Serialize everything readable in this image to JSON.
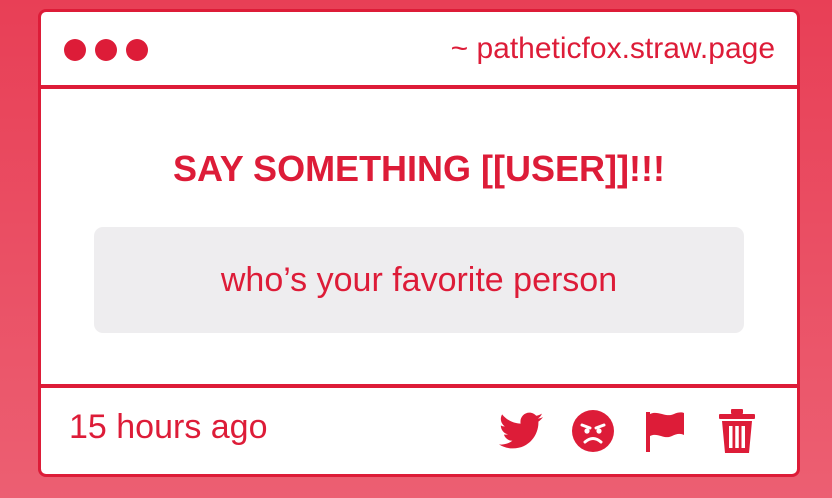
{
  "window": {
    "url": "~ patheticfox.straw.page"
  },
  "post": {
    "heading": "SAY SOMETHING [[USER]]!!!",
    "question": "who’s your favorite person",
    "timestamp": "15 hours ago"
  },
  "actions": [
    {
      "icon": "twitter-icon"
    },
    {
      "icon": "angry-face-icon"
    },
    {
      "icon": "flag-icon"
    },
    {
      "icon": "trash-icon"
    }
  ],
  "colors": {
    "accent": "#dd1c38",
    "background_top": "#e83f56",
    "background_bottom": "#ec5f72",
    "card": "#ffffff",
    "question_box": "#eeedef"
  }
}
